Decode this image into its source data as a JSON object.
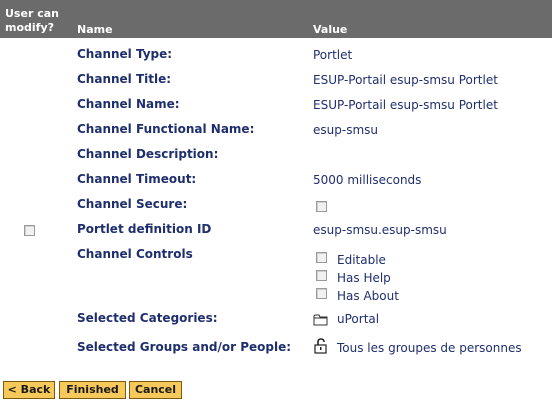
{
  "header": {
    "modify_line1": "User can",
    "modify_line2": "modify?",
    "name": "Name",
    "value": "Value"
  },
  "fields": {
    "type": {
      "label": "Channel Type:",
      "value": "Portlet"
    },
    "title": {
      "label": "Channel Title:",
      "value": "ESUP-Portail esup-smsu Portlet"
    },
    "name": {
      "label": "Channel Name:",
      "value": "ESUP-Portail esup-smsu Portlet"
    },
    "fname": {
      "label": "Channel Functional Name:",
      "value": "esup-smsu"
    },
    "description": {
      "label": "Channel Description:",
      "value": ""
    },
    "timeout": {
      "label": "Channel Timeout:",
      "value": "5000 milliseconds"
    },
    "secure": {
      "label": "Channel Secure:",
      "checked": false
    },
    "portlet_id": {
      "label": "Portlet definition ID",
      "value": "esup-smsu.esup-smsu",
      "user_can_modify": false
    }
  },
  "controls": {
    "label": "Channel Controls",
    "items": [
      {
        "label": "Editable",
        "checked": false
      },
      {
        "label": "Has Help",
        "checked": false
      },
      {
        "label": "Has About",
        "checked": false
      }
    ]
  },
  "categories": {
    "label": "Selected Categories:",
    "value": "uPortal",
    "icon": "folder-icon"
  },
  "groups": {
    "label": "Selected Groups and/or People:",
    "value": "Tous les groupes de personnes",
    "icon": "padlock-icon"
  },
  "buttons": {
    "back": "< Back",
    "finished": "Finished",
    "cancel": "Cancel"
  },
  "colors": {
    "header_bg": "#6b6b6b",
    "text": "#1f2f6e",
    "button_bg": "#f7c85a"
  }
}
